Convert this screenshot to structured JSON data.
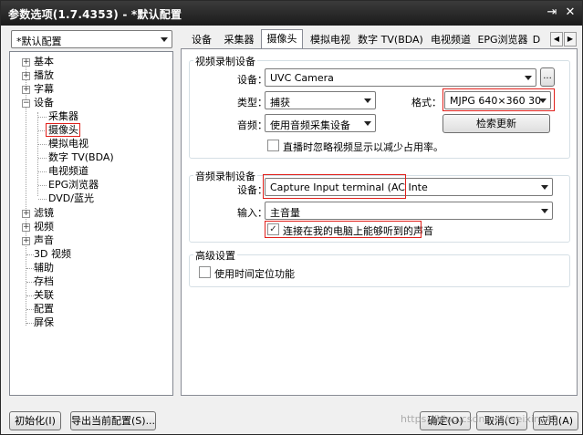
{
  "window": {
    "title": "参数选项(1.7.4353) - *默认配置",
    "pin_glyph": "⇥",
    "close_glyph": "✕"
  },
  "profile_combo": {
    "value": "*默认配置"
  },
  "tree": {
    "items": [
      {
        "label": "基本",
        "expander": "+"
      },
      {
        "label": "播放",
        "expander": "+"
      },
      {
        "label": "字幕",
        "expander": "+"
      },
      {
        "label": "设备",
        "expander": "−"
      },
      {
        "label": "采集器"
      },
      {
        "label": "摄像头"
      },
      {
        "label": "模拟电视"
      },
      {
        "label": "数字 TV(BDA)"
      },
      {
        "label": "电视频道"
      },
      {
        "label": "EPG浏览器"
      },
      {
        "label": "DVD/蓝光"
      },
      {
        "label": "滤镜",
        "expander": "+"
      },
      {
        "label": "视频",
        "expander": "+"
      },
      {
        "label": "声音",
        "expander": "+"
      },
      {
        "label": "3D 视频"
      },
      {
        "label": "辅助"
      },
      {
        "label": "存档"
      },
      {
        "label": "关联"
      },
      {
        "label": "配置"
      },
      {
        "label": "屏保"
      }
    ]
  },
  "tabs": [
    {
      "label": "设备"
    },
    {
      "label": "采集器"
    },
    {
      "label": "摄像头"
    },
    {
      "label": "模拟电视"
    },
    {
      "label": "数字 TV(BDA)"
    },
    {
      "label": "电视频道"
    },
    {
      "label": "EPG浏览器"
    },
    {
      "label": "D"
    }
  ],
  "tab_nav": {
    "prev": "◀",
    "next": "▶"
  },
  "video_group": {
    "title": "视频录制设备",
    "device_label": "设备：",
    "device_value": "UVC Camera",
    "browse_label": "...",
    "type_label": "类型：",
    "type_value": "捕获",
    "format_label": "格式：",
    "format_value": "MJPG 640×360 30",
    "audio_label": "音频：",
    "audio_value": "使用音频采集设备",
    "refresh_label": "检索更新",
    "ignore_label": "直播时忽略视频显示以减少占用率。"
  },
  "audio_group": {
    "title": "音频录制设备",
    "device_label": "设备：",
    "device_value": "Capture Input terminal (AC Inte",
    "input_label": "输入：",
    "input_value": "主音量",
    "connect_label": "连接在我的电脑上能够听到的声音",
    "connect_mark": "✓"
  },
  "advanced_group": {
    "title": "高级设置",
    "timecode_label": "使用时间定位功能"
  },
  "footer": {
    "init_label": "初始化(I)",
    "export_label": "导出当前配置(S)...",
    "ok_label": "确定(O)",
    "cancel_label": "取消(C)",
    "apply_label": "应用(A)"
  },
  "watermark": "https://blog.csdn.net/weixin_42"
}
